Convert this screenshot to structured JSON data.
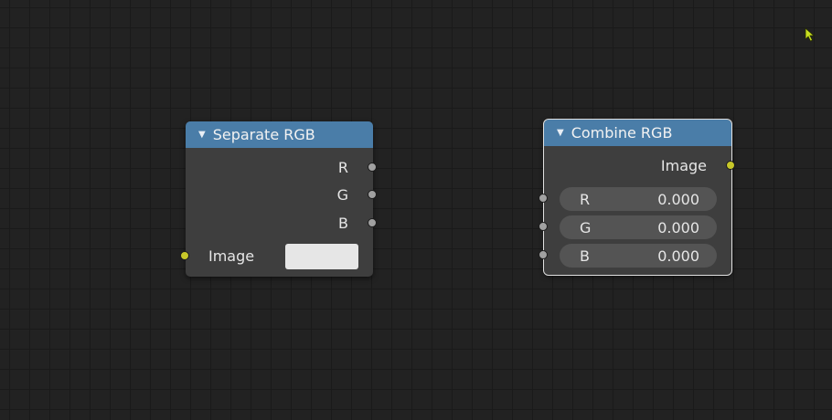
{
  "separate_rgb": {
    "title": "Separate RGB",
    "outputs": [
      "R",
      "G",
      "B"
    ],
    "input_label": "Image",
    "swatch_color": "#e6e6e6"
  },
  "combine_rgb": {
    "title": "Combine RGB",
    "output_label": "Image",
    "inputs": [
      {
        "label": "R",
        "value": "0.000"
      },
      {
        "label": "G",
        "value": "0.000"
      },
      {
        "label": "B",
        "value": "0.000"
      }
    ]
  },
  "colors": {
    "background": "#222222",
    "grid": "#1a1a1a",
    "node_body": "#3e3e3e",
    "node_header": "#4a7da8",
    "socket_color": "#c7c729",
    "socket_value": "#a1a1a1",
    "field": "#545454",
    "cursor": "#c8e020"
  },
  "icons": {
    "collapse": "triangle-down-icon",
    "cursor": "mouse-pointer-icon"
  }
}
